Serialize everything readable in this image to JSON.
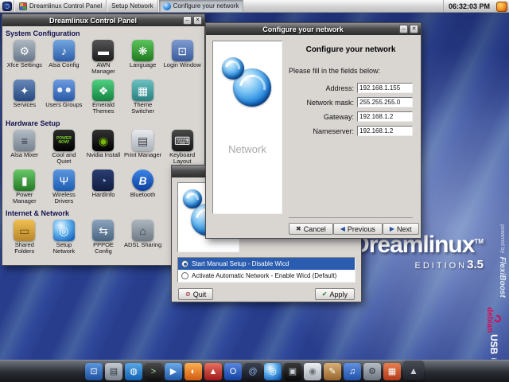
{
  "window_controls": {
    "minimize": "–",
    "close": "✕"
  },
  "taskbar": {
    "clock": "06:32:03 PM",
    "tasks": [
      {
        "label": "Dreamlinux Control Panel"
      },
      {
        "label": "Setup Network"
      },
      {
        "label": "Configure your network"
      }
    ]
  },
  "control_panel": {
    "title": "Dreamlinux Control Panel",
    "sections": {
      "system": "System Configuration",
      "hardware": "Hardware Setup",
      "network": "Internet & Network"
    },
    "items": [
      {
        "label": "Xfce Settings",
        "glyph": "⚙"
      },
      {
        "label": "Alsa Config",
        "glyph": "♪"
      },
      {
        "label": "AWN Manager",
        "glyph": "▬"
      },
      {
        "label": "Language",
        "glyph": "❋"
      },
      {
        "label": "Login Window",
        "glyph": "⊡"
      },
      {
        "label": "Services",
        "glyph": "✦"
      },
      {
        "label": "Users Groups",
        "glyph": "☻☻"
      },
      {
        "label": "Emerald Themes",
        "glyph": "❖"
      },
      {
        "label": "Theme Switcher",
        "glyph": "▦"
      },
      {
        "label": "Alsa Mixer",
        "glyph": "≡"
      },
      {
        "label": "Cool and Quiet",
        "glyph": "POWER NOW!"
      },
      {
        "label": "Nvidia Install",
        "glyph": "◉"
      },
      {
        "label": "Print Manager",
        "glyph": "▤"
      },
      {
        "label": "Keyboard Layout",
        "glyph": "⌨"
      },
      {
        "label": "Power Manager",
        "glyph": "▮"
      },
      {
        "label": "Wireless Drivers",
        "glyph": "Ψ"
      },
      {
        "label": "HardInfo",
        "glyph": "◔"
      },
      {
        "label": "Bluetooth",
        "glyph": "B"
      },
      {
        "label": "Shared Folders",
        "glyph": "▭"
      },
      {
        "label": "Setup Network",
        "glyph": "◎"
      },
      {
        "label": "PPPOE Config",
        "glyph": "⇆"
      },
      {
        "label": "ADSL Sharing",
        "glyph": "⌂"
      }
    ]
  },
  "setup_network": {
    "title": "Setup Network",
    "options": [
      {
        "label": "Start Manual Setup - Disable Wicd"
      },
      {
        "label": "Activate Automatic Network - Enable Wicd (Default)"
      }
    ],
    "buttons": {
      "quit": "Quit",
      "apply": "Apply"
    },
    "button_icons": {
      "quit": "⊘",
      "apply": "✔"
    }
  },
  "configure_dialog": {
    "title": "Configure your network",
    "heading": "Configure your network",
    "instruction": "Please fill in the fields below:",
    "pane_label": "Network",
    "fields": [
      {
        "label": "Address:",
        "value": "192.168.1.155"
      },
      {
        "label": "Network mask:",
        "value": "255.255.255.0"
      },
      {
        "label": "Gateway:",
        "value": "192.168.1.2"
      },
      {
        "label": "Nameserver:",
        "value": "192.168.1.2"
      }
    ],
    "buttons": {
      "cancel": "Cancel",
      "previous": "Previous",
      "next": "Next"
    },
    "button_icons": {
      "cancel": "✖",
      "previous": "◀",
      "next": "▶"
    }
  },
  "branding": {
    "logo": "Dreamlinux",
    "tm": "TM",
    "edition": "EDITION",
    "version": "3.5",
    "powered_by": "powered by",
    "flexiboost": "FlexiBoost",
    "usb": "USB",
    "install": "install",
    "debian": "debian"
  },
  "dock": {
    "items": [
      {
        "name": "display-settings",
        "glyph": "⊡"
      },
      {
        "name": "file-manager",
        "glyph": "▤"
      },
      {
        "name": "web-browser",
        "glyph": "◍"
      },
      {
        "name": "terminal",
        "glyph": ">"
      },
      {
        "name": "media-player",
        "glyph": "▶"
      },
      {
        "name": "firefox",
        "glyph": "◐"
      },
      {
        "name": "pdf-reader",
        "glyph": "▲"
      },
      {
        "name": "opera",
        "glyph": "O"
      },
      {
        "name": "dreamlinux",
        "glyph": "@"
      },
      {
        "name": "network",
        "glyph": "◎"
      },
      {
        "name": "camera",
        "glyph": "▣"
      },
      {
        "name": "cd-burner",
        "glyph": "◉"
      },
      {
        "name": "image-editor",
        "glyph": "✎"
      },
      {
        "name": "music-player",
        "glyph": "♫"
      },
      {
        "name": "system-tools",
        "glyph": "⚙"
      },
      {
        "name": "package-manager",
        "glyph": "▦"
      },
      {
        "name": "show-desktop",
        "glyph": "▲"
      }
    ]
  }
}
